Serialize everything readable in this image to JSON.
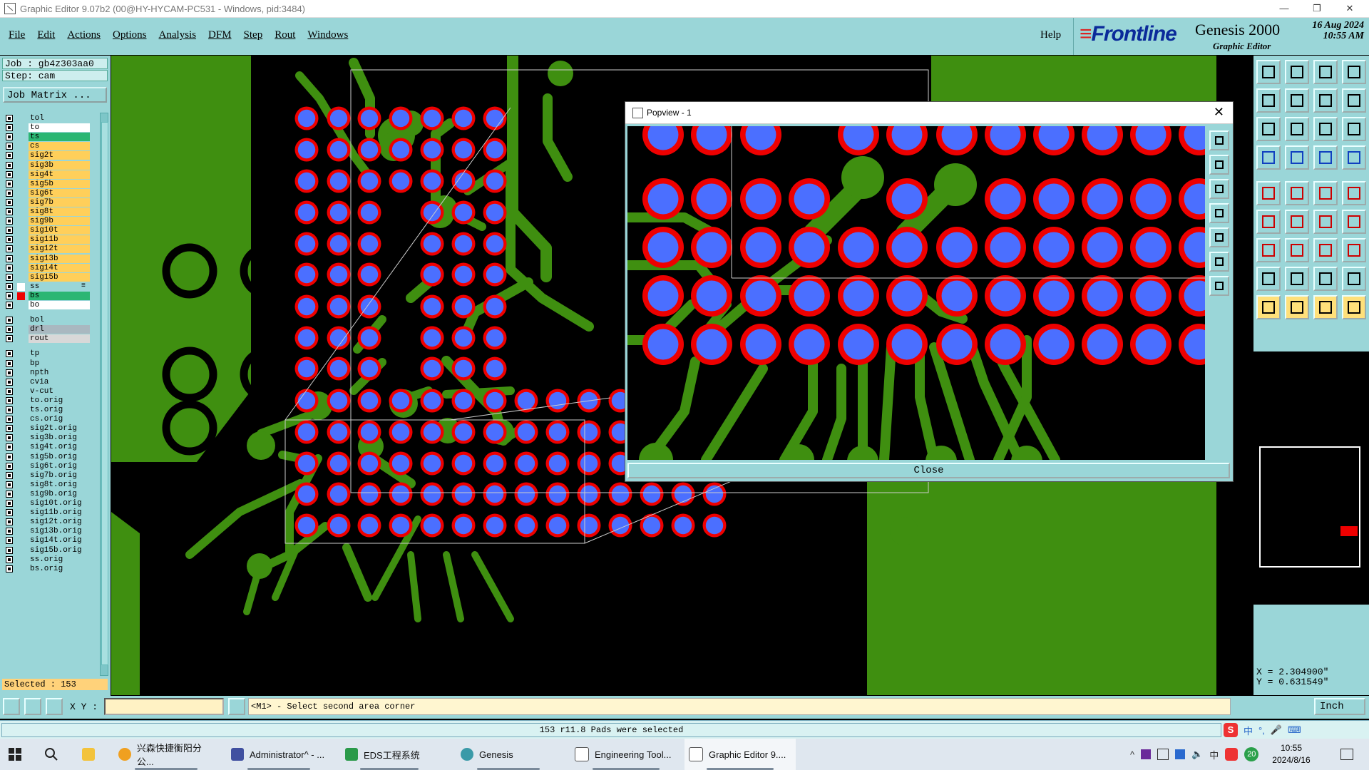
{
  "window": {
    "title": "Graphic Editor 9.07b2 (00@HY-HYCAM-PC531 - Windows, pid:3484)",
    "controls": [
      "—",
      "❐",
      "✕"
    ]
  },
  "menubar": {
    "items": [
      "File",
      "Edit",
      "Actions",
      "Options",
      "Analysis",
      "DFM",
      "Step",
      "Rout",
      "Windows"
    ],
    "help": "Help"
  },
  "brand": {
    "logo": "Frontline",
    "product": "Genesis 2000",
    "subtitle": "Graphic Editor",
    "date": "16 Aug 2024",
    "time": "10:55 AM"
  },
  "job": {
    "job_label": "Job : gb4z303aa0",
    "step_label": "Step: cam",
    "matrix_button": "Job Matrix ..."
  },
  "layers": [
    {
      "name": "tol",
      "color": "#9ad6d8"
    },
    {
      "name": "to",
      "color": "#ffffff"
    },
    {
      "name": "ts",
      "color": "#2bb673"
    },
    {
      "name": "cs",
      "color": "#ffcf5a"
    },
    {
      "name": "sig2t",
      "color": "#ffcf5a"
    },
    {
      "name": "sig3b",
      "color": "#ffcf5a"
    },
    {
      "name": "sig4t",
      "color": "#ffcf5a"
    },
    {
      "name": "sig5b",
      "color": "#ffcf5a"
    },
    {
      "name": "sig6t",
      "color": "#ffcf5a"
    },
    {
      "name": "sig7b",
      "color": "#ffcf5a"
    },
    {
      "name": "sig8t",
      "color": "#ffcf5a"
    },
    {
      "name": "sig9b",
      "color": "#ffcf5a"
    },
    {
      "name": "sig10t",
      "color": "#ffcf5a"
    },
    {
      "name": "sig11b",
      "color": "#ffcf5a"
    },
    {
      "name": "sig12t",
      "color": "#ffcf5a"
    },
    {
      "name": "sig13b",
      "color": "#ffcf5a"
    },
    {
      "name": "sig14t",
      "color": "#ffcf5a"
    },
    {
      "name": "sig15b",
      "color": "#ffcf5a"
    },
    {
      "name": "ss",
      "color": "#9ad6d8",
      "marker": "≡"
    },
    {
      "name": "bs",
      "color": "#2bb673"
    },
    {
      "name": "bo",
      "color": "#ffffff"
    },
    {
      "name": "bol",
      "color": "#9ad6d8"
    },
    {
      "name": "drl",
      "color": "#a9b8c0"
    },
    {
      "name": "rout",
      "color": "#d8d8d8"
    },
    {
      "name": "tp",
      "color": "#9ad6d8"
    },
    {
      "name": "bp",
      "color": "#9ad6d8"
    },
    {
      "name": "npth",
      "color": "#9ad6d8"
    },
    {
      "name": "cvia",
      "color": "#9ad6d8"
    },
    {
      "name": "v-cut",
      "color": "#9ad6d8"
    },
    {
      "name": "to.orig",
      "color": "#9ad6d8"
    },
    {
      "name": "ts.orig",
      "color": "#9ad6d8"
    },
    {
      "name": "cs.orig",
      "color": "#9ad6d8"
    },
    {
      "name": "sig2t.orig",
      "color": "#9ad6d8"
    },
    {
      "name": "sig3b.orig",
      "color": "#9ad6d8"
    },
    {
      "name": "sig4t.orig",
      "color": "#9ad6d8"
    },
    {
      "name": "sig5b.orig",
      "color": "#9ad6d8"
    },
    {
      "name": "sig6t.orig",
      "color": "#9ad6d8"
    },
    {
      "name": "sig7b.orig",
      "color": "#9ad6d8"
    },
    {
      "name": "sig8t.orig",
      "color": "#9ad6d8"
    },
    {
      "name": "sig9b.orig",
      "color": "#9ad6d8"
    },
    {
      "name": "sig10t.orig",
      "color": "#9ad6d8"
    },
    {
      "name": "sig11b.orig",
      "color": "#9ad6d8"
    },
    {
      "name": "sig12t.orig",
      "color": "#9ad6d8"
    },
    {
      "name": "sig13b.orig",
      "color": "#9ad6d8"
    },
    {
      "name": "sig14t.orig",
      "color": "#9ad6d8"
    },
    {
      "name": "sig15b.orig",
      "color": "#9ad6d8"
    },
    {
      "name": "ss.orig",
      "color": "#9ad6d8"
    },
    {
      "name": "bs.orig",
      "color": "#9ad6d8"
    }
  ],
  "selected_label": "Selected : 153",
  "popup": {
    "title": "Popview - 1",
    "close_label": "Close"
  },
  "coords": {
    "x": "X = 2.304900\"",
    "y": "Y = 0.631549\""
  },
  "command": {
    "xy_label": "X Y :",
    "xy_value": "",
    "prompt": "<M1> - Select second area corner",
    "unit": "Inch"
  },
  "status": {
    "message": "153 r11.8 Pads were selected",
    "ime": [
      "中",
      "°,",
      "🎤",
      "⌨"
    ]
  },
  "colors": {
    "copper": "#3f8f10",
    "pad_ring": "#ee0000",
    "pad_fill": "#4b6fff",
    "panel": "#9ad6d8"
  },
  "taskbar": {
    "items": [
      {
        "label": "兴森快捷衡阳分公...",
        "icon": "folder-orange-icon"
      },
      {
        "label": "Administrator^ - ...",
        "icon": "server-icon"
      },
      {
        "label": "EDS工程系统",
        "icon": "eds-icon"
      },
      {
        "label": "Genesis",
        "icon": "genesis-icon"
      },
      {
        "label": "Engineering Tool...",
        "icon": "genesis-window-icon"
      },
      {
        "label": "Graphic Editor 9....",
        "icon": "genesis-window-icon"
      }
    ],
    "tray": [
      "^",
      "中",
      "20"
    ],
    "time": "10:55",
    "date": "2024/8/16"
  }
}
